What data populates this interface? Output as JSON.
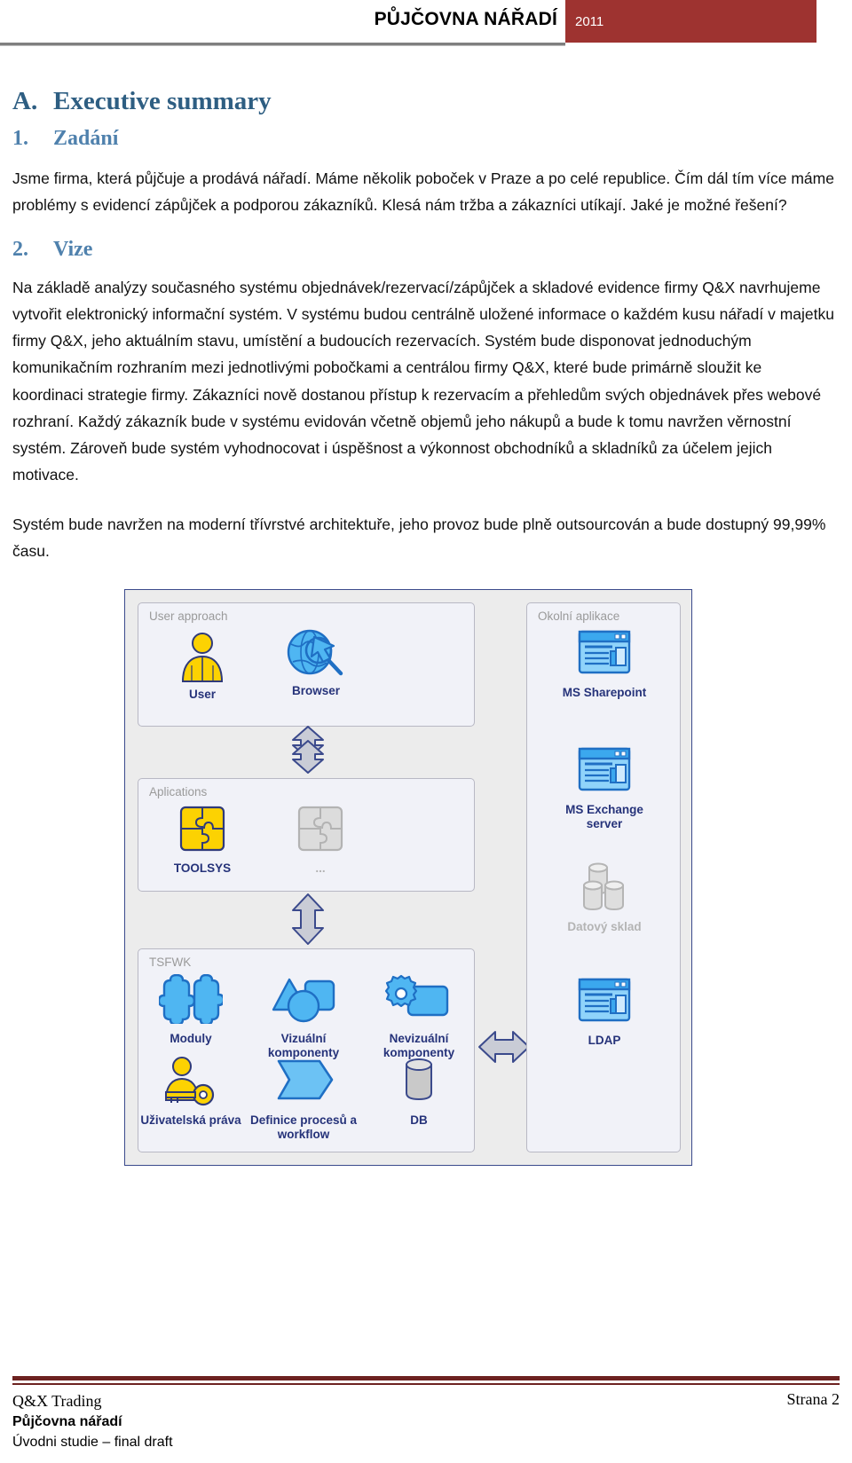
{
  "header": {
    "title": "PŮJČOVNA NÁŘADÍ",
    "year": "2011",
    "accent_color": "#9e3330"
  },
  "document": {
    "section_a": {
      "number": "A.",
      "title": "Executive summary"
    },
    "section_1": {
      "number": "1.",
      "title": "Zadání",
      "paragraph": "Jsme firma, která půjčuje a prodává nářadí. Máme několik poboček v Praze a po celé republice. Čím dál tím více máme problémy s evidencí zápůjček a podporou zákazníků. Klesá nám tržba a zákazníci utíkají. Jaké je možné řešení?"
    },
    "section_2": {
      "number": "2.",
      "title": "Vize",
      "paragraph_1": "Na základě analýzy současného systému objednávek/rezervací/zápůjček a skladové evidence firmy Q&X navrhujeme vytvořit elektronický informační systém. V systému budou centrálně uložené informace o každém kusu nářadí v majetku firmy Q&X, jeho aktuálním stavu, umístění a budoucích rezervacích. Systém bude disponovat jednoduchým komunikačním rozhraním mezi jednotlivými pobočkami a centrálou firmy Q&X, které bude primárně sloužit ke koordinaci strategie firmy. Zákazníci nově dostanou přístup k rezervacím a přehledům svých objednávek přes webové rozhraní. Každý zákazník bude v systému evidován včetně objemů jeho nákupů a bude k tomu navržen věrnostní systém. Zároveň bude systém vyhodnocovat i úspěšnost a výkonnost obchodníků a skladníků za účelem jejich motivace.",
      "paragraph_2": "Systém bude navržen na moderní třívrstvé architektuře, jeho provoz bude plně outsourcován a bude dostupný 99,99% času."
    }
  },
  "diagram": {
    "groups": [
      {
        "label": "User approach"
      },
      {
        "label": "Aplications"
      },
      {
        "label": "TSFWK"
      },
      {
        "label": "Okolní aplikace"
      }
    ],
    "nodes": {
      "user": "User",
      "browser": "Browser",
      "toolsys": "TOOLSYS",
      "ellipsis": "...",
      "moduly": "Moduly",
      "vizualni": "Vizuální komponenty",
      "nevizualni": "Nevizuální komponenty",
      "uzivatelska_prava": "Uživatelská práva",
      "definice_procesu": "Definice procesů a workflow",
      "db": "DB",
      "sharepoint": "MS Sharepoint",
      "exchange": "MS Exchange server",
      "datovy_sklad": "Datový sklad",
      "ldap": "LDAP"
    },
    "colors": {
      "frame_border": "#3b4a8c",
      "frame_fill": "#ececec",
      "group_fill": "#f1f2f8",
      "icon_blue": "#3ba8ee",
      "icon_blue_dark": "#1f6fc4",
      "icon_yellow": "#fcd202",
      "icon_gray": "#c9c9c9",
      "caption_color": "#26337a"
    }
  },
  "footer": {
    "company": "Q&X Trading",
    "project": "Půjčovna nářadí",
    "subtitle": "Úvodni studie – final draft",
    "page": "Strana 2",
    "rule_color": "#6d2220"
  }
}
